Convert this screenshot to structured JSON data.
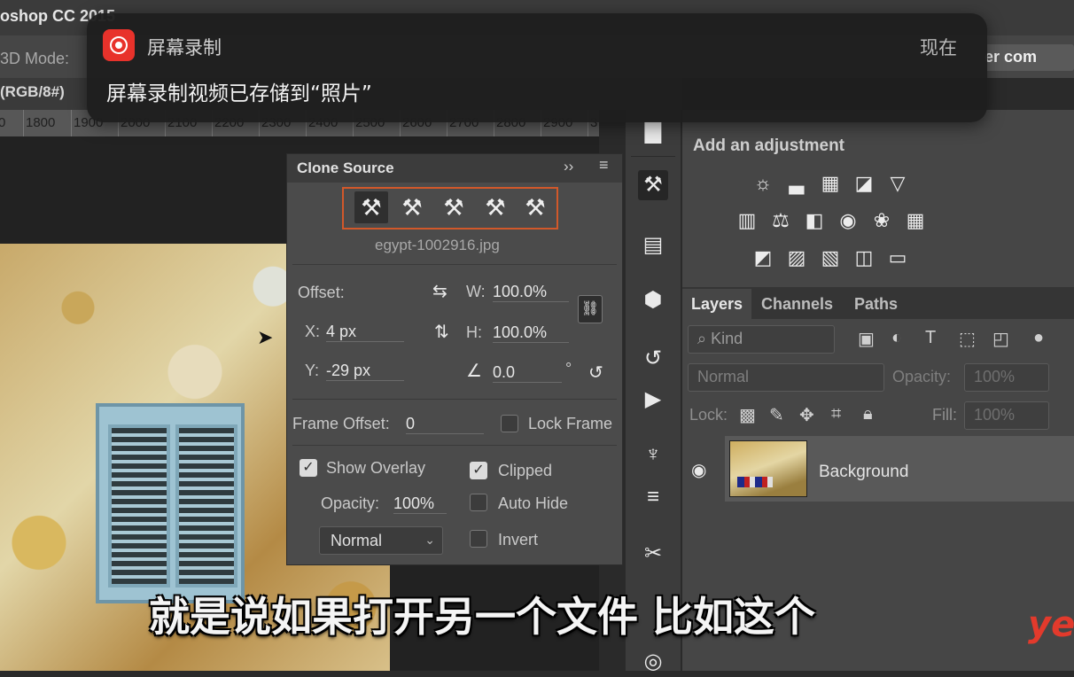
{
  "app": {
    "title": "oshop CC 2015",
    "mode_label": "3D Mode:",
    "right_field": "er com",
    "doc_tab": "(RGB/8#)"
  },
  "ruler": {
    "ticks": [
      "1800",
      "1800",
      "1900",
      "2000",
      "2100",
      "2200",
      "2300",
      "2400",
      "2500",
      "2600",
      "2700",
      "2800",
      "2900",
      "3"
    ]
  },
  "clone_source": {
    "title": "Clone Source",
    "expand_icon": "double-chevron-right-icon",
    "filename": "egypt-1002916.jpg",
    "offset_label": "Offset:",
    "x_label": "X:",
    "x_value": "4 px",
    "y_label": "Y:",
    "y_value": "-29 px",
    "w_label": "W:",
    "w_value": "100.0%",
    "h_label": "H:",
    "h_value": "100.0%",
    "angle_value": "0.0",
    "degree_symbol": "°",
    "frame_offset_label": "Frame Offset:",
    "frame_offset_value": "0",
    "lock_frame_label": "Lock Frame",
    "show_overlay_label": "Show Overlay",
    "opacity_label": "Opacity:",
    "opacity_value": "100%",
    "clipped_label": "Clipped",
    "auto_hide_label": "Auto Hide",
    "invert_label": "Invert",
    "blend_mode": "Normal",
    "show_overlay_checked": true,
    "clipped_checked": true,
    "auto_hide_checked": false,
    "invert_checked": false,
    "lock_frame_checked": false
  },
  "adjustments": {
    "title": "Add an adjustment"
  },
  "layers": {
    "tabs": [
      "Layers",
      "Channels",
      "Paths"
    ],
    "kind_placeholder": "Kind",
    "blend_mode": "Normal",
    "opacity_label": "Opacity:",
    "opacity_value": "100%",
    "lock_label": "Lock:",
    "fill_label": "Fill:",
    "fill_value": "100%",
    "layer_name": "Background"
  },
  "notification": {
    "app": "屏幕录制",
    "time": "现在",
    "message": "屏幕录制视频已存储到“照片”"
  },
  "subtitle": "就是说如果打开另一个文件 比如这个",
  "watermark": "ye",
  "colors": {
    "accent_orange": "#d2582a",
    "notif_red": "#e8322b",
    "panel_bg": "#4b4b4b"
  }
}
